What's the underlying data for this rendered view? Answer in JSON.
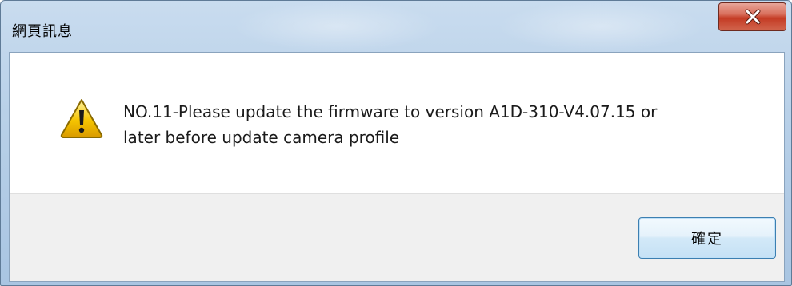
{
  "window": {
    "title": "網頁訊息"
  },
  "dialog": {
    "icon": "warning-icon",
    "message_line1": "NO.11-Please update the firmware to version A1D-310-V4.07.15 or",
    "message_line2": "later before update camera profile"
  },
  "buttons": {
    "ok_label": "確定",
    "close_icon": "close-icon"
  },
  "colors": {
    "frame": "#b8d0e8",
    "close_button": "#c43b24",
    "button_panel": "#f0f0f0",
    "ok_border": "#3c7fb1",
    "warning_yellow": "#f5c400"
  }
}
